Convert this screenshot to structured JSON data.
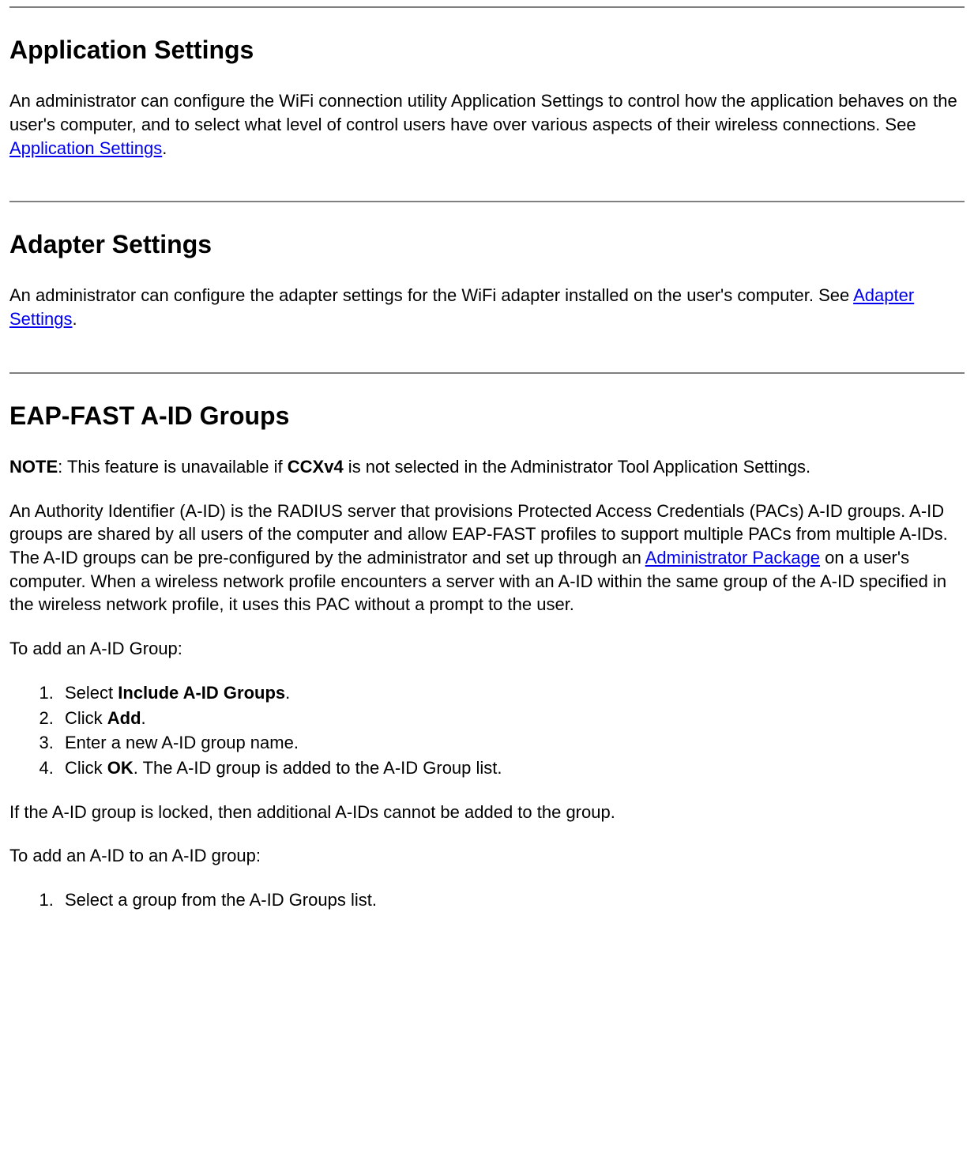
{
  "section1": {
    "heading": "Application Settings",
    "para_before_link": "An administrator can configure the WiFi connection utility Application Settings to control how the application behaves on the user's computer, and to select what level of control users have over various aspects of their wireless connections. See ",
    "link_text": "Application Settings",
    "para_after_link": "."
  },
  "section2": {
    "heading": "Adapter Settings",
    "para_before_link": "An administrator can configure the adapter settings for the WiFi adapter installed on the user's computer. See ",
    "link_text": "Adapter Settings",
    "para_after_link": "."
  },
  "section3": {
    "heading": "EAP-FAST A-ID Groups",
    "note_label": "NOTE",
    "note_before_bold": ": This feature is unavailable if ",
    "note_bold": "CCXv4",
    "note_after_bold": " is not selected in the Administrator Tool Application Settings.",
    "para2_before_link": "An Authority Identifier (A-ID) is the RADIUS server that provisions Protected Access Credentials (PACs) A-ID groups. A-ID groups are shared by all users of the computer and allow EAP-FAST profiles to support multiple PACs from multiple A-IDs. The A-ID groups can be pre-configured by the administrator and set up through an ",
    "para2_link": "Administrator Package",
    "para2_after_link": " on a user's computer. When a wireless network profile encounters a server with an A-ID within the same group of the A-ID specified in the wireless network profile, it uses this PAC without a prompt to the user.",
    "para3": "To add an A-ID Group:",
    "list1": {
      "item1_before": "Select ",
      "item1_bold": "Include A-ID Groups",
      "item1_after": ".",
      "item2_before": "Click ",
      "item2_bold": "Add",
      "item2_after": ".",
      "item3": "Enter a new A-ID group name.",
      "item4_before": "Click ",
      "item4_bold": "OK",
      "item4_after": ". The A-ID group is added to the A-ID Group list."
    },
    "para4": "If the A-ID group is locked, then additional A-IDs cannot be added to the group.",
    "para5": "To add an A-ID to an A-ID group:",
    "list2": {
      "item1": "Select a group from the A-ID Groups list."
    }
  }
}
